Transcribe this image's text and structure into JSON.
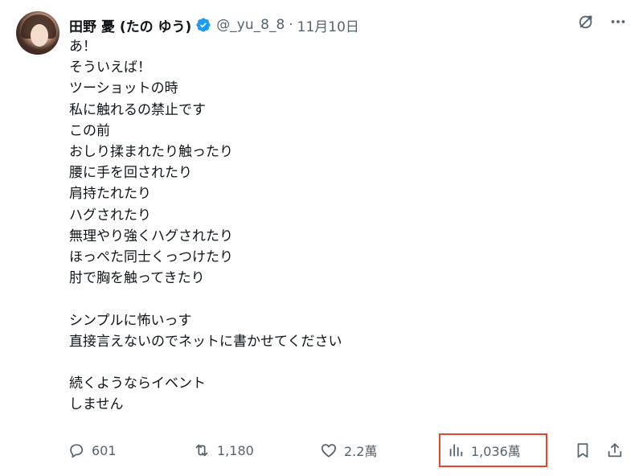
{
  "author": {
    "display_name": "田野 憂 (たの ゆう)",
    "handle": "@_yu_8_8",
    "separator": "·",
    "date": "11月10日",
    "verified_color": "#1d9bf0"
  },
  "tweet": {
    "text": "あ！\nそういえば！\nツーショットの時\n私に触れるの禁止です\nこの前\nおしり揉まれたり触ったり\n腰に手を回されたり\n肩持たれたり\nハグされたり\n無理やり強くハグされたり\nほっぺた同士くっつけたり\n肘で胸を触ってきたり\n\nシンプルに怖いっす\n直接言えないのでネットに書かせてください\n\n続くようならイベント\nしません"
  },
  "actions": {
    "replies": "601",
    "reposts": "1,180",
    "likes": "2.2萬",
    "views": "1,036萬"
  },
  "icons": {
    "grok": "grok-icon",
    "more": "more-icon",
    "reply": "reply-icon",
    "repost": "repost-icon",
    "like": "heart-icon",
    "views": "views-icon",
    "bookmark": "bookmark-icon",
    "share": "share-icon"
  },
  "colors": {
    "text": "#0f1419",
    "secondary": "#536471",
    "highlight_box": "#e8452f"
  }
}
